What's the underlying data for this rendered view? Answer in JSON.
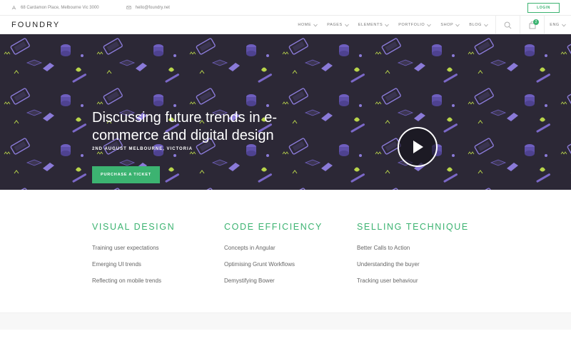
{
  "topbar": {
    "address": "68 Cardamon Place, Melbourne Vic 3000",
    "email": "hello@foundry.net",
    "login_label": "LOGIN"
  },
  "nav": {
    "logo": "FOUNDRY",
    "items": [
      {
        "label": "HOME"
      },
      {
        "label": "PAGES"
      },
      {
        "label": "ELEMENTS"
      },
      {
        "label": "PORTFOLIO"
      },
      {
        "label": "SHOP"
      },
      {
        "label": "BLOG"
      }
    ],
    "cart_count": "2",
    "language": "ENG"
  },
  "hero": {
    "title": "Discussing future trends in e-commerce and digital design",
    "subtitle": "2ND AUGUST MELBOURNE, VICTORIA",
    "cta_label": "PURCHASE A TICKET"
  },
  "features": [
    {
      "title": "VISUAL DESIGN",
      "items": [
        "Training user expectations",
        "Emerging UI trends",
        "Reflecting on mobile trends"
      ]
    },
    {
      "title": "CODE EFFICIENCY",
      "items": [
        "Concepts in Angular",
        "Optimising Grunt Workflows",
        "Demystifying Bower"
      ]
    },
    {
      "title": "SELLING TECHNIQUE",
      "items": [
        "Better Calls to Action",
        "Understanding the buyer",
        "Tracking user behaviour"
      ]
    }
  ],
  "colors": {
    "accent": "#3cb371",
    "hero_bg": "#2c2836",
    "pattern_purple": "#7b68c8",
    "pattern_lime": "#b8d44a"
  }
}
